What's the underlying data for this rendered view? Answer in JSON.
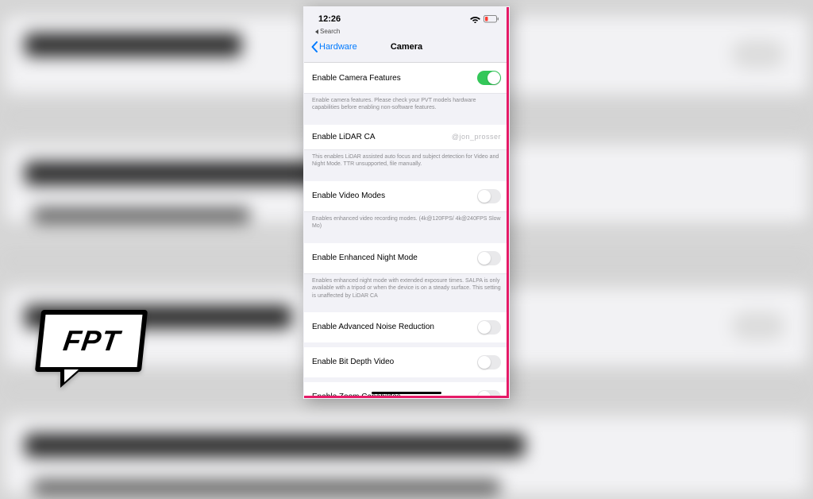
{
  "logo": {
    "text": "FPT"
  },
  "statusbar": {
    "time": "12:26",
    "back_hint": "Search"
  },
  "navbar": {
    "back_label": "Hardware",
    "title": "Camera"
  },
  "watermark": "@jon_prosser",
  "settings": [
    {
      "label": "Enable Camera Features",
      "on": true,
      "footer": "Enable camera features. Please check your PVT models hardware capabilities before enabling non-software features."
    },
    {
      "label": "Enable LiDAR CA",
      "on": false,
      "show_watermark_instead_of_switch": true,
      "footer": "This enables LiDAR assisted auto focus and subject detection for Video and Night Mode. TTR unsupported, file manually."
    },
    {
      "label": "Enable Video Modes",
      "on": false,
      "footer": "Enables enhanced video recording modes. (4k@120FPS/ 4k@240FPS Slow Mo)"
    },
    {
      "label": "Enable Enhanced Night Mode",
      "on": false,
      "footer": "Enables enhanced night mode with extended exposure times. SALPA is only available with a tripod or when the device is on a steady surface. This setting is unaffected by LiDAR CA"
    },
    {
      "label": "Enable Advanced Noise Reduction",
      "on": false
    },
    {
      "label": "Enable Bit Depth Video",
      "on": false
    },
    {
      "label": "Enable Zoom Capabilites",
      "on": false
    }
  ],
  "colors": {
    "ios_blue": "#007aff",
    "ios_green": "#34c759",
    "accent_edge": "#e51b67"
  }
}
